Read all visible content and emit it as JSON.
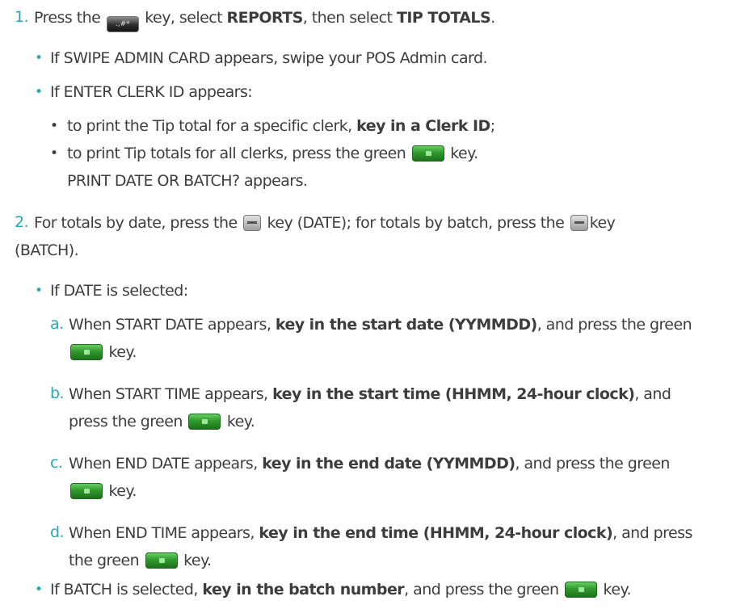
{
  "step1": {
    "number": "1.",
    "text_a": "Press the",
    "key_icon": "hash-key-icon",
    "key_label": ".,#*",
    "text_b": "key, select",
    "bold_a": "REPORTS",
    "text_c": ", then select",
    "bold_b": "TIP TOTALS",
    "text_d": ".",
    "bullets": [
      {
        "text": "If SWIPE ADMIN CARD appears, swipe your POS Admin card."
      },
      {
        "text": "If ENTER CLERK ID appears:"
      }
    ],
    "sub": [
      {
        "text_a": "to print the Tip total for a specific clerk,",
        "bold": "key in a Clerk ID",
        "text_b": ";"
      },
      {
        "text_a": "to print Tip totals for all clerks, press the green",
        "text_b": "key."
      }
    ],
    "after": "PRINT DATE OR BATCH? appears."
  },
  "step2": {
    "number": "2.",
    "text_a": "For totals by date, press the",
    "text_b": "key (DATE); for totals by batch, press the",
    "text_c": "key",
    "text_d": "(BATCH).",
    "date_bullet": "If DATE is selected:",
    "items": [
      {
        "letter": "a.",
        "pre": "When START DATE appears,",
        "bold": "key in the start date (YYMMDD)",
        "post": ", and press the green",
        "end": "key."
      },
      {
        "letter": "b.",
        "pre": "When START TIME appears,",
        "bold": "key in the start time (HHMM, 24-hour clock)",
        "post": ", and",
        "post2": "press the green",
        "end": "key."
      },
      {
        "letter": "c.",
        "pre": "When END DATE appears,",
        "bold": "key in the end date (YYMMDD)",
        "post": ", and press the green",
        "end": "key."
      },
      {
        "letter": "d.",
        "pre": "When END TIME appears,",
        "bold": "key in the end time (HHMM, 24-hour clock)",
        "post": ", and press",
        "post2": "the green",
        "end": "key."
      }
    ],
    "batch": {
      "pre": "If BATCH is selected,",
      "bold": "key in the batch number",
      "post": ", and press the green",
      "end": "key."
    }
  }
}
